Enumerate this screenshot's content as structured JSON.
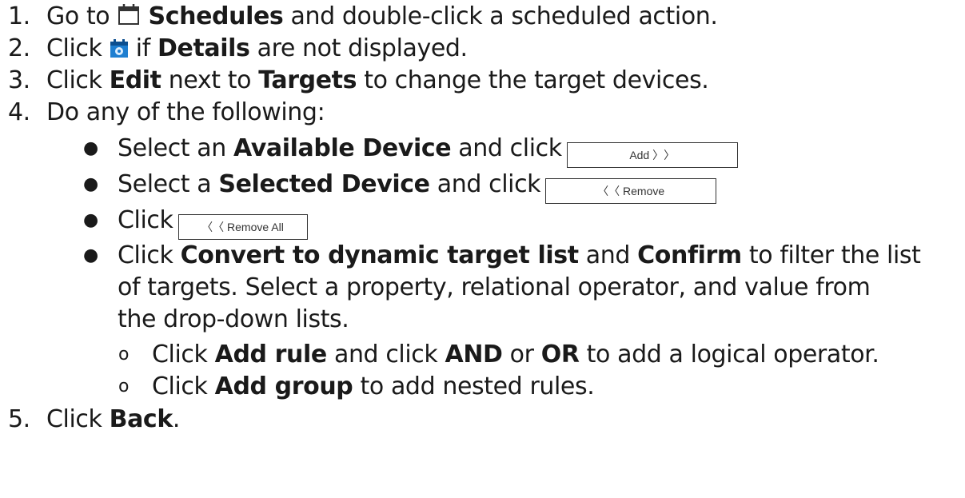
{
  "steps": [
    {
      "num": "1.",
      "pre": "Go to ",
      "bold": "Schedules",
      "post": " and double-click a scheduled action.",
      "icon": "calendar-icon"
    },
    {
      "num": "2.",
      "pre": "Click ",
      "mid": " if ",
      "bold": "Details",
      "post": " are not displayed.",
      "icon": "details-calendar-gear-icon"
    },
    {
      "num": "3.",
      "pre": "Click ",
      "bold1": "Edit",
      "mid": " next to ",
      "bold2": "Targets",
      "post": " to change the target devices."
    },
    {
      "num": "4.",
      "text": "Do any of the following:"
    },
    {
      "num": "5.",
      "pre": "Click ",
      "bold": "Back",
      "post": "."
    }
  ],
  "bullets": [
    {
      "pre": "Select an ",
      "bold": "Available Device",
      "post": " and click",
      "button_label": "Add 〉〉"
    },
    {
      "pre": "Select a ",
      "bold": "Selected Device",
      "post": " and click",
      "button_label": "〈〈 Remove"
    },
    {
      "pre": "Click",
      "button_label": "〈〈 Remove All"
    },
    {
      "pre": "Click ",
      "bold1": "Convert to dynamic target list",
      "mid": " and ",
      "bold2": "Confirm",
      "post": " to filter the list",
      "line2": "of targets. Select a property, relational operator, and value from",
      "line3": "the drop-down lists."
    }
  ],
  "sub_bullets": [
    {
      "marker": "o",
      "pre": "Click ",
      "bold1": "Add rule",
      "mid1": " and click ",
      "bold2": "AND",
      "mid2": " or ",
      "bold3": "OR",
      "post": " to add a logical operator."
    },
    {
      "marker": "o",
      "pre": "Click ",
      "bold": "Add group",
      "post": " to add nested rules."
    }
  ],
  "colors": {
    "text": "#1a1a1a",
    "icon_blue": "#1f7fd1"
  }
}
